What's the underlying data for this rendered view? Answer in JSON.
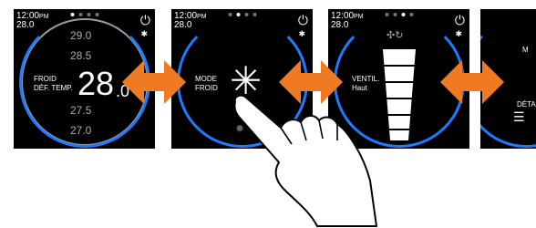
{
  "screen1": {
    "time": "12:00",
    "ampm": "PM",
    "outdoor": "28.0",
    "mode_line1": "FROID",
    "mode_line2": "DÉF. TEMP.",
    "setpoint": "28",
    "setpoint_dec": ".0",
    "list": [
      "29.0",
      "28.5",
      "27.5",
      "27.0"
    ]
  },
  "screen2": {
    "time": "12:00",
    "ampm": "PM",
    "outdoor": "28.0",
    "label1": "MODE",
    "label2": "FROID"
  },
  "screen3": {
    "time": "12:00",
    "ampm": "PM",
    "outdoor": "28.0",
    "label1": "VENTIL.",
    "label2": "Haut"
  },
  "screen4": {
    "label1": "M",
    "label2": "DÉTA"
  },
  "colors": {
    "accent": "#1e7bff",
    "arrow": "#f07a21"
  }
}
